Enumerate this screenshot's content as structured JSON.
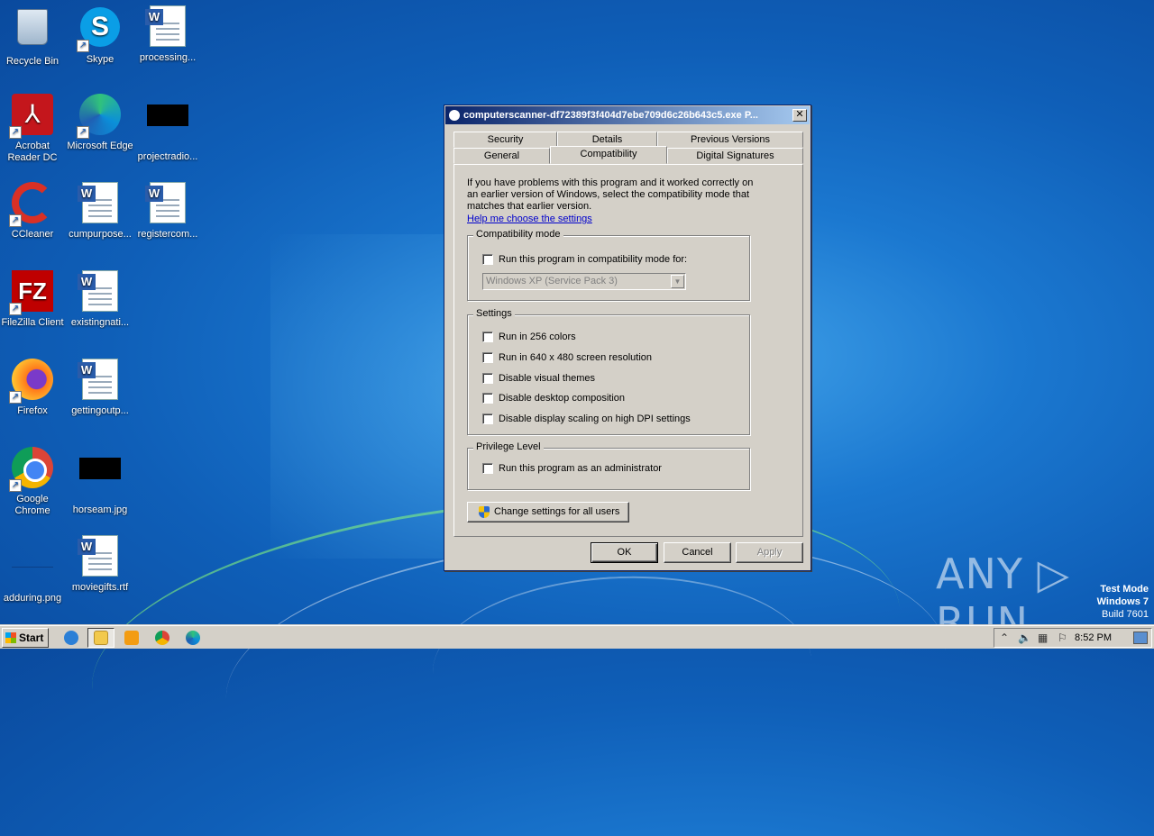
{
  "desktop": {
    "icons": [
      {
        "label": "Recycle Bin"
      },
      {
        "label": "Skype"
      },
      {
        "label": "processing..."
      },
      {
        "label": "Acrobat Reader DC"
      },
      {
        "label": "Microsoft Edge"
      },
      {
        "label": "projectradio..."
      },
      {
        "label": "CCleaner"
      },
      {
        "label": "cumpurpose..."
      },
      {
        "label": "registercom..."
      },
      {
        "label": "FileZilla Client"
      },
      {
        "label": "existingnati..."
      },
      {
        "label": "Firefox"
      },
      {
        "label": "gettingoutp..."
      },
      {
        "label": "Google Chrome"
      },
      {
        "label": "horseam.jpg"
      },
      {
        "label": "adduring.png"
      },
      {
        "label": "moviegifts.rtf"
      }
    ]
  },
  "dialog": {
    "title": "computerscanner-df72389f3f404d7ebe709d6c26b643c5.exe P...",
    "close_glyph": "✕",
    "tabs_row1": [
      "Security",
      "Details",
      "Previous Versions"
    ],
    "tabs_row2": [
      "General",
      "Compatibility",
      "Digital Signatures"
    ],
    "active_tab": "Compatibility",
    "intro": "If you have problems with this program and it worked correctly on an earlier version of Windows, select the compatibility mode that matches that earlier version.",
    "help_link": "Help me choose the settings",
    "compat_group": {
      "legend": "Compatibility mode",
      "checkbox": "Run this program in compatibility mode for:",
      "select_value": "Windows XP (Service Pack 3)"
    },
    "settings_group": {
      "legend": "Settings",
      "options": [
        "Run in 256 colors",
        "Run in 640 x 480 screen resolution",
        "Disable visual themes",
        "Disable desktop composition",
        "Disable display scaling on high DPI settings"
      ]
    },
    "privilege_group": {
      "legend": "Privilege Level",
      "checkbox": "Run this program as an administrator"
    },
    "change_all_users": "Change settings for all users",
    "buttons": {
      "ok": "OK",
      "cancel": "Cancel",
      "apply": "Apply"
    }
  },
  "watermark": {
    "text": "ANY ▷ RUN"
  },
  "sysinfo": {
    "line1": "Test Mode",
    "line2": "Windows 7",
    "line3": "Build 7601"
  },
  "taskbar": {
    "start_label": "Start",
    "pinned": [
      "ie-icon",
      "explorer-icon",
      "media-player-icon",
      "chrome-icon",
      "edge-icon"
    ],
    "clock": "8:52 PM"
  },
  "colors": {
    "desktop_blue": "#1b78d0",
    "titlebar_start": "#0a246a",
    "titlebar_end": "#a6caf0",
    "dialog_face": "#d4d0c8",
    "link": "#0000cc"
  }
}
